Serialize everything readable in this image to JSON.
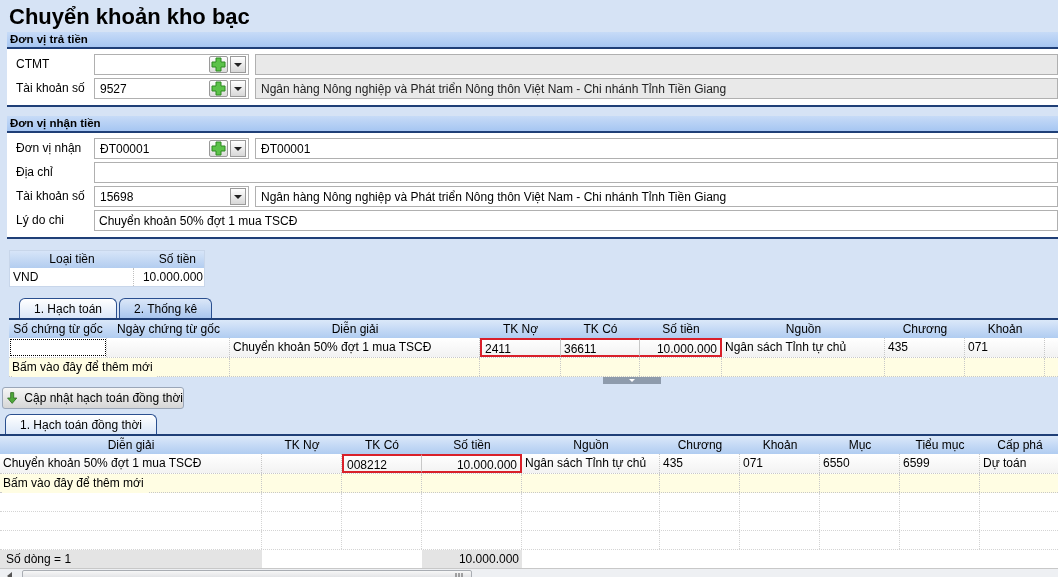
{
  "title": "Chuyển khoản kho bạc",
  "payer": {
    "heading": "Đơn vị trả tiền",
    "rows": [
      {
        "kind": "combo_add",
        "label": "CTMT",
        "name_disabled": true
      },
      {
        "kind": "combo_add",
        "label": "Tài khoản số",
        "value": "9527",
        "name": "Ngân hàng Nông nghiệp và Phát triển Nông thôn Việt Nam - Chi nhánh Tỉnh Tiền Giang",
        "name_disabled": true
      }
    ]
  },
  "receiver": {
    "heading": "Đơn vị nhận tiền",
    "rows": [
      {
        "kind": "combo_add",
        "label": "Đơn vị nhận",
        "value": "ĐT00001",
        "name": "ĐT00001",
        "name_disabled": false
      },
      {
        "kind": "text",
        "label": "Địa chỉ"
      },
      {
        "kind": "combo",
        "label": "Tài khoản số",
        "value": "15698",
        "name": "Ngân hàng Nông nghiệp và Phát triển Nông thôn Việt Nam - Chi nhánh Tỉnh Tiền Giang",
        "name_disabled": false
      },
      {
        "kind": "text",
        "label": "Lý do chi",
        "value": "Chuyển khoản 50% đợt 1 mua TSCĐ"
      }
    ]
  },
  "currency": {
    "columns": [
      "Loại tiền",
      "Số tiền"
    ],
    "rows": [
      [
        "VND",
        "10.000.000"
      ]
    ]
  },
  "tabs_top": [
    {
      "label": "1. Hạch toán",
      "selected": true
    },
    {
      "label": "2. Thống kê",
      "selected": false
    }
  ],
  "grid_top": {
    "columns": [
      "Số chứng từ gốc",
      "Ngày chứng từ gốc",
      "Diễn giải",
      "TK Nợ",
      "TK Có",
      "Số tiền",
      "Nguồn",
      "Chương",
      "Khoản"
    ],
    "rows": [
      {
        "cells": [
          {
            "focused": true
          },
          {},
          {
            "text": "Chuyển khoản 50% đợt 1 mua TSCĐ"
          },
          {
            "text": "2411",
            "marked": true
          },
          {
            "text": "36611",
            "marked": true
          },
          {
            "text": "10.000.000",
            "marked": true
          },
          {
            "text": "Ngân sách Tỉnh tự chủ"
          },
          {
            "text": "435"
          },
          {
            "text": "071"
          }
        ]
      }
    ],
    "add_row_text": "Bấm vào đây để thêm mới"
  },
  "update_button": "Cập nhật hạch toán đồng thời",
  "tabs_bottom": [
    {
      "label": "1. Hạch toán đồng thời",
      "selected": true
    }
  ],
  "grid_bottom": {
    "columns": [
      "Diễn giải",
      "TK Nợ",
      "TK Có",
      "Số tiền",
      "Nguồn",
      "Chương",
      "Khoản",
      "Mục",
      "Tiểu mục",
      "Cấp phá"
    ],
    "rows": [
      {
        "cells": [
          {
            "text": "Chuyển khoản 50% đợt 1 mua TSCĐ"
          },
          {},
          {
            "text": "008212",
            "marked": true
          },
          {
            "text": "10.000.000",
            "marked": true
          },
          {
            "text": "Ngân sách Tỉnh tự chủ"
          },
          {
            "text": "435"
          },
          {
            "text": "071"
          },
          {
            "text": "6550"
          },
          {
            "text": "6599"
          },
          {
            "text": "Dự toán"
          }
        ]
      }
    ],
    "add_row_text": "Bấm vào đây để thêm mới",
    "footer": {
      "count": "Số dòng = 1",
      "total": "10.000.000"
    }
  }
}
